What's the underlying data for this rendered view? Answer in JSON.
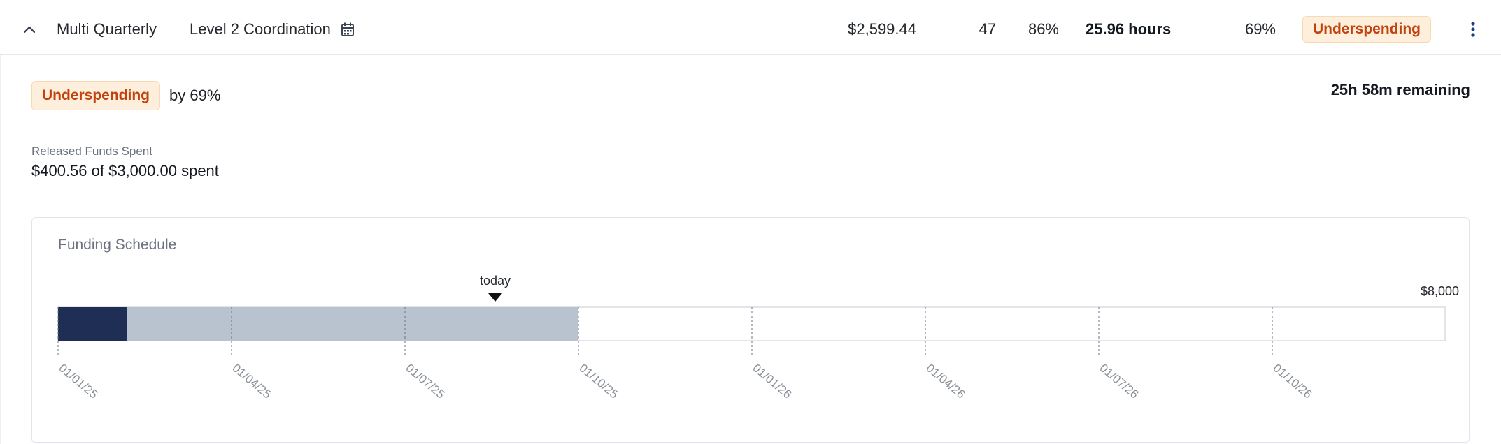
{
  "row": {
    "name": "Multi Quarterly",
    "level": "Level 2 Coordination",
    "amount": "$2,599.44",
    "count": "47",
    "percent_a": "86%",
    "hours": "25.96 hours",
    "percent_b": "69%",
    "status": "Underspending"
  },
  "detail": {
    "status_badge": "Underspending",
    "status_suffix": "by 69%",
    "remaining": "25h 58m remaining",
    "released_label": "Released Funds Spent",
    "released_value": "$400.56 of $3,000.00 spent"
  },
  "schedule": {
    "title": "Funding Schedule",
    "today_label": "today",
    "max_label": "$8,000",
    "ticks": [
      "01/01/25",
      "01/04/25",
      "01/07/25",
      "01/10/25",
      "01/01/26",
      "01/04/26",
      "01/07/26",
      "01/10/26"
    ]
  },
  "colors": {
    "spent": "#1e2e55",
    "released": "#b9c3d0",
    "badge_bg": "#fdefdc",
    "badge_text": "#c2410c"
  },
  "icons": [
    "chevron-up-icon",
    "calendar-icon",
    "kebab-menu-icon",
    "today-marker-icon"
  ]
}
